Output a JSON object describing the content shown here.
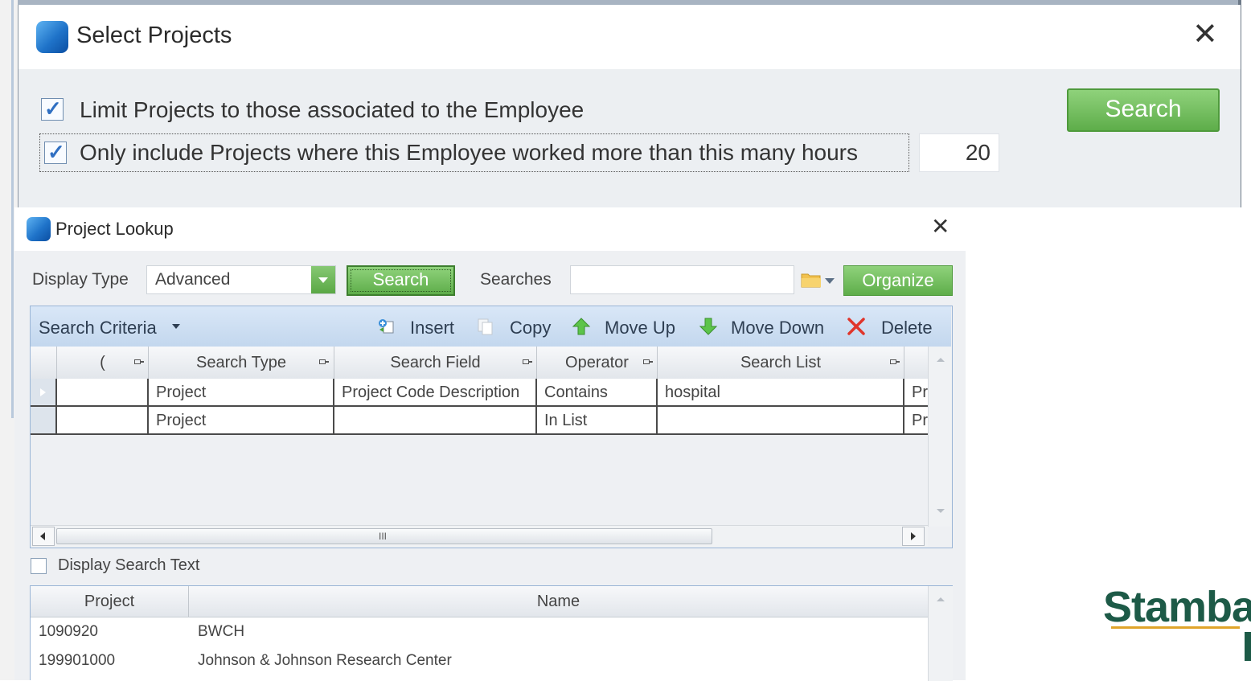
{
  "select_projects": {
    "title": "Select Projects",
    "close_glyph": "✕",
    "limit_label": "Limit Projects to those associated to the Employee",
    "limit_checked": true,
    "hours_label": "Only include Projects where this Employee worked more than this many hours",
    "hours_checked": true,
    "hours_value": "20",
    "search_label": "Search"
  },
  "project_lookup": {
    "title": "Project Lookup",
    "close_glyph": "✕",
    "display_type_label": "Display Type",
    "display_type_value": "Advanced",
    "search_label": "Search",
    "searches_label": "Searches",
    "searches_value": "",
    "organize_label": "Organize",
    "criteria": {
      "title": "Search Criteria",
      "toolbar": {
        "insert": "Insert",
        "copy": "Copy",
        "move_up": "Move Up",
        "move_down": "Move Down",
        "delete": "Delete"
      },
      "columns": [
        "(",
        "Search Type",
        "Search Field",
        "Operator",
        "Search List"
      ],
      "rows": [
        {
          "paren": "",
          "search_type": "Project",
          "search_field": "Project Code Description",
          "operator": "Contains",
          "search_list": "hospital",
          "extra": "Pr"
        },
        {
          "paren": "",
          "search_type": "Project",
          "search_field": "",
          "operator": "In List",
          "search_list": "",
          "extra": "Pr"
        }
      ],
      "scroll_grip": "III"
    },
    "display_search_text_label": "Display Search Text",
    "display_search_text_checked": false,
    "results": {
      "columns": [
        "Project",
        "Name"
      ],
      "rows": [
        {
          "project": "1090920",
          "name": "BWCH"
        },
        {
          "project": "199901000",
          "name": "Johnson & Johnson Research Center"
        }
      ]
    }
  },
  "logo_text": "Stamba",
  "colors": {
    "accent_green": "#5ead4a",
    "header_blue": "#c3d7ee",
    "logo_green": "#1d5a47",
    "logo_gold": "#e0a42a"
  }
}
